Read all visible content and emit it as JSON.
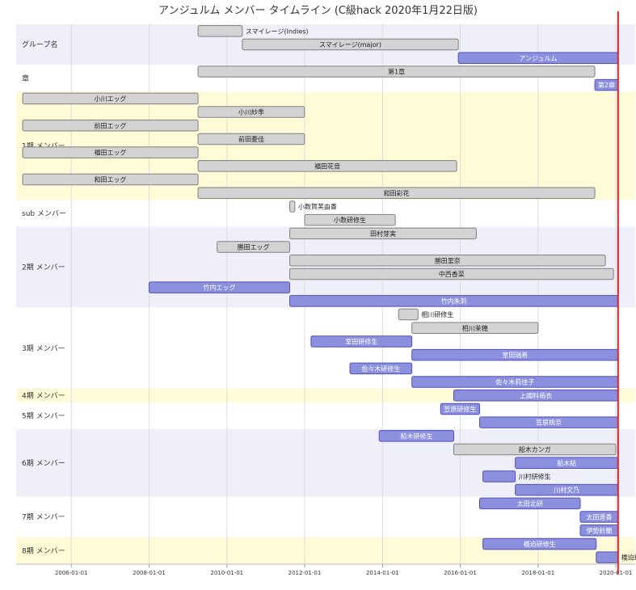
{
  "chart_data": {
    "type": "gantt",
    "title": "アンジュルム メンバー タイムライン (C級hack 2020年1月22日版)",
    "x_range": [
      "2004-08-01",
      "2020-07-01"
    ],
    "x_ticks": [
      "2006-01-01",
      "2008-01-01",
      "2010-01-01",
      "2012-01-01",
      "2014-01-01",
      "2016-01-01",
      "2018-01-01",
      "2020-01-01"
    ],
    "today": "2020-01-22",
    "colors": {
      "done_fill": "#d3d3d3",
      "done_stroke": "#808080",
      "active_fill": "#8a90dd",
      "active_stroke": "#534fbc",
      "today_line": "#e0202a",
      "band_purple": "#efeffa",
      "band_yellow": "#fffbd6",
      "band_white": "#ffffff",
      "grid": "#dddddd"
    },
    "sections": [
      {
        "name": "グループ名",
        "band": "purple",
        "tasks": [
          {
            "label": "スマイレージ(Indies)",
            "start": "2009-04-05",
            "end": "2010-05-26",
            "status": "done"
          },
          {
            "label": "スマイレージ(major)",
            "start": "2010-05-26",
            "end": "2015-12-14",
            "status": "done"
          },
          {
            "label": "アンジュルム",
            "start": "2015-12-14",
            "end": "2020-01-22",
            "status": "active"
          }
        ]
      },
      {
        "name": "章",
        "band": "white",
        "tasks": [
          {
            "label": "第1章",
            "start": "2009-04-05",
            "end": "2019-06-18",
            "status": "done"
          },
          {
            "label": "第2章",
            "start": "2019-06-18",
            "end": "2020-01-22",
            "status": "active"
          }
        ]
      },
      {
        "name": "1期 メンバー",
        "band": "yellow",
        "tasks": [
          {
            "label": "小川エッグ",
            "start": "2004-10-01",
            "end": "2009-04-05",
            "status": "done"
          },
          {
            "label": "小川紗季",
            "start": "2009-04-05",
            "end": "2011-12-31",
            "status": "done"
          },
          {
            "label": "前田エッグ",
            "start": "2004-10-01",
            "end": "2009-04-05",
            "status": "done"
          },
          {
            "label": "前田憂佳",
            "start": "2009-04-05",
            "end": "2011-12-31",
            "status": "done"
          },
          {
            "label": "福田エッグ",
            "start": "2004-10-01",
            "end": "2009-04-05",
            "status": "done"
          },
          {
            "label": "福田花音",
            "start": "2009-04-05",
            "end": "2015-11-29",
            "status": "done"
          },
          {
            "label": "和田エッグ",
            "start": "2004-10-01",
            "end": "2009-04-05",
            "status": "done"
          },
          {
            "label": "和田彩花",
            "start": "2009-04-05",
            "end": "2019-06-18",
            "status": "done"
          }
        ]
      },
      {
        "name": "sub メンバー",
        "band": "white",
        "tasks": [
          {
            "label": "小数賀芙由香",
            "start": "2011-08-14",
            "end": "2011-10-01",
            "status": "done"
          },
          {
            "label": "小数研修生",
            "start": "2012-01-01",
            "end": "2014-05-01",
            "status": "done"
          }
        ]
      },
      {
        "name": "2期 メンバー",
        "band": "purple",
        "tasks": [
          {
            "label": "田村芽実",
            "start": "2011-08-14",
            "end": "2016-05-31",
            "status": "done"
          },
          {
            "label": "勝田エッグ",
            "start": "2009-10-01",
            "end": "2011-08-14",
            "status": "done"
          },
          {
            "label": "勝田里奈",
            "start": "2011-08-14",
            "end": "2019-09-25",
            "status": "done"
          },
          {
            "label": "中西香菜",
            "start": "2011-08-14",
            "end": "2019-12-10",
            "status": "done"
          },
          {
            "label": "竹内エッグ",
            "start": "2008-01-01",
            "end": "2011-08-14",
            "status": "active"
          },
          {
            "label": "竹内朱莉",
            "start": "2011-08-14",
            "end": "2020-01-22",
            "status": "active"
          }
        ]
      },
      {
        "name": "3期 メンバー",
        "band": "white",
        "tasks": [
          {
            "label": "相川研修生",
            "start": "2014-06-01",
            "end": "2014-12-01",
            "status": "done"
          },
          {
            "label": "相川茉穂",
            "start": "2014-10-04",
            "end": "2018-01-01",
            "status": "done"
          },
          {
            "label": "室田研修生",
            "start": "2012-03-01",
            "end": "2014-10-04",
            "status": "active"
          },
          {
            "label": "室田瑞希",
            "start": "2014-10-04",
            "end": "2020-01-22",
            "status": "active"
          },
          {
            "label": "佐々木研修生",
            "start": "2013-03-01",
            "end": "2014-10-04",
            "status": "active"
          },
          {
            "label": "佐々木莉佳子",
            "start": "2014-10-04",
            "end": "2020-01-22",
            "status": "active"
          }
        ]
      },
      {
        "name": "4期 メンバー",
        "band": "yellow",
        "tasks": [
          {
            "label": "上國料萌衣",
            "start": "2015-11-01",
            "end": "2020-01-22",
            "status": "active"
          }
        ]
      },
      {
        "name": "5期 メンバー",
        "band": "white",
        "tasks": [
          {
            "label": "笠原研修生",
            "start": "2015-07-01",
            "end": "2016-07-01",
            "status": "active"
          },
          {
            "label": "笠原桃奈",
            "start": "2016-07-01",
            "end": "2020-01-22",
            "status": "active"
          }
        ]
      },
      {
        "name": "6期 メンバー",
        "band": "purple",
        "tasks": [
          {
            "label": "船木研修生",
            "start": "2013-12-01",
            "end": "2015-11-01",
            "status": "active"
          },
          {
            "label": "船木カンガ",
            "start": "2015-11-01",
            "end": "2020-01-01",
            "status": "done"
          },
          {
            "label": "船木結",
            "start": "2017-06-01",
            "end": "2020-01-22",
            "status": "active"
          },
          {
            "label": "川村研修生",
            "start": "2016-08-01",
            "end": "2017-06-01",
            "status": "active"
          },
          {
            "label": "川村文乃",
            "start": "2017-06-01",
            "end": "2020-01-22",
            "status": "active"
          }
        ]
      },
      {
        "name": "7期 メンバー",
        "band": "white",
        "tasks": [
          {
            "label": "太田北研",
            "start": "2016-07-01",
            "end": "2019-02-01",
            "status": "active"
          },
          {
            "label": "太田遥香",
            "start": "2019-02-01",
            "end": "2020-01-22",
            "status": "active"
          },
          {
            "label": "伊勢鈴蘭",
            "start": "2019-02-01",
            "end": "2020-01-22",
            "status": "active"
          }
        ]
      },
      {
        "name": "8期 メンバー",
        "band": "yellow",
        "tasks": [
          {
            "label": "橋迫研修生",
            "start": "2016-08-01",
            "end": "2019-07-01",
            "status": "active"
          },
          {
            "label": "橋迫鈴",
            "start": "2019-07-01",
            "end": "2020-01-22",
            "status": "active"
          }
        ]
      }
    ]
  }
}
